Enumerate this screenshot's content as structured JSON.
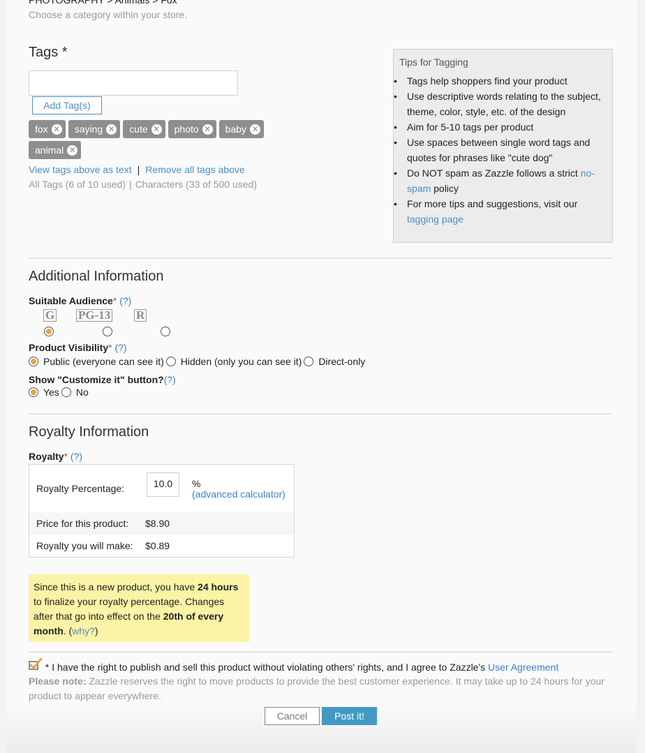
{
  "category": {
    "breadcrumb": "PHOTOGRAPHY > Animals > Fox",
    "hint": "Choose a category within your store."
  },
  "tags": {
    "title": "Tags *",
    "input_value": "",
    "add_button": "Add Tag(s)",
    "items": [
      "fox",
      "saying",
      "cute",
      "photo",
      "baby",
      "animal"
    ],
    "remove_icon": "circle-x-icon",
    "view_as_text": "View tags above as text",
    "link_separator": "|",
    "remove_all": "Remove all tags above",
    "count_tags": "All Tags (6 of 10 used)",
    "count_separator": "|",
    "count_chars": "Characters (33 of 500 used)"
  },
  "tips": {
    "title": "Tips for Tagging",
    "items": [
      {
        "text": "Tags help shoppers find your product"
      },
      {
        "text": "Use descriptive words relating to the subject, theme, color, style, etc. of the design"
      },
      {
        "text": "Aim for 5-10 tags per product"
      },
      {
        "text": "Use spaces between single word tags and quotes for phrases like \"cute dog\""
      },
      {
        "text_before": "Do NOT spam as Zazzle follows a strict ",
        "link": "no-spam",
        "text_after": " policy"
      },
      {
        "text_before": "For more tips and suggestions, visit our ",
        "link": "tagging page",
        "text_after": ""
      }
    ]
  },
  "additional": {
    "title": "Additional Information",
    "audience": {
      "label": "Suitable Audience",
      "required": "*",
      "help": "(?)",
      "options": [
        {
          "label": "G",
          "checked": true
        },
        {
          "label": "PG-13",
          "checked": false
        },
        {
          "label": "R",
          "checked": false
        }
      ]
    },
    "visibility": {
      "label": "Product Visibility",
      "required": "*",
      "help": "(?)",
      "options": [
        {
          "label": "Public (everyone can see it)",
          "checked": true
        },
        {
          "label": "Hidden (only you can see it)",
          "checked": false
        },
        {
          "label": "Direct-only",
          "checked": false
        }
      ]
    },
    "customize": {
      "label": "Show \"Customize it\" button?",
      "help": "(?)",
      "options": [
        {
          "label": "Yes",
          "checked": true
        },
        {
          "label": "No",
          "checked": false
        }
      ]
    }
  },
  "royalty": {
    "title": "Royalty Information",
    "label": "Royalty",
    "required": "*",
    "help": "(?)",
    "percentage_label": "Royalty Percentage:",
    "percentage_value": "10.0",
    "percent_sign": "%",
    "calculator_link": "(advanced calculator)",
    "price_label": "Price for this product:",
    "price_value": "$8.90",
    "earn_label": "Royalty you will make:",
    "earn_value": "$0.89"
  },
  "notice": {
    "t1": "Since this is a new product, you have ",
    "b1": "24 hours",
    "t2": " to finalize your royalty percentage. Changes after that go into effect on the ",
    "b2": "20th of every month",
    "t3": ". (",
    "link": "why?",
    "t4": ")"
  },
  "agreement": {
    "checked": true,
    "text": "* I have the right to publish and sell this product without violating others' rights, and I agree to Zazzle's ",
    "link": "User Agreement",
    "note_label": "Please note:",
    "note_text": " Zazzle reserves the right to move products to provide the best customer experience. It may take up to 24 hours for your product to appear everywhere."
  },
  "actions": {
    "cancel": "Cancel",
    "post": "Post it!"
  },
  "colors": {
    "accent_link": "#4a90c8",
    "radio_checked": "#f0a040",
    "primary_button": "#4299c4",
    "tag_chip": "#8e8e8e",
    "notice_bg": "#fbf3a5"
  }
}
